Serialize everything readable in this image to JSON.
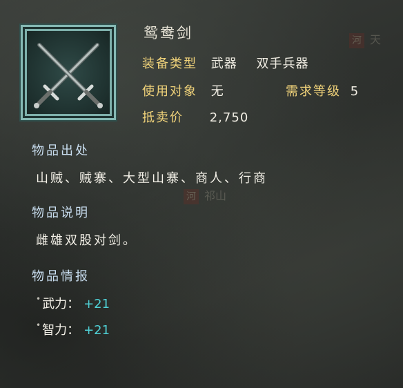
{
  "item": {
    "name": "鸳鸯剑",
    "icon": "crossed-swords-icon",
    "type_label": "装备类型",
    "type_value1": "武器",
    "type_value2": "双手兵器",
    "user_label": "使用对象",
    "user_value": "无",
    "level_label": "需求等级",
    "level_value": "5",
    "price_label": "抵卖价",
    "price_value": "2,750"
  },
  "sections": {
    "source_title": "物品出处",
    "source_text": "山贼、贼寨、大型山寨、商人、行商",
    "desc_title": "物品说明",
    "desc_text": "雌雄双股对剑。",
    "info_title": "物品情报"
  },
  "stats": [
    {
      "name": "武力：",
      "value": "+21"
    },
    {
      "name": "智力：",
      "value": "+21"
    }
  ],
  "background": {
    "seal1": "河",
    "place1": "天",
    "seal2": "河",
    "place2": "祁山"
  },
  "colors": {
    "label_gold": "#f1d37a",
    "bonus_cyan": "#4fd1d6",
    "section_blue": "#c9def0",
    "frame_teal": "#86b9b4"
  }
}
